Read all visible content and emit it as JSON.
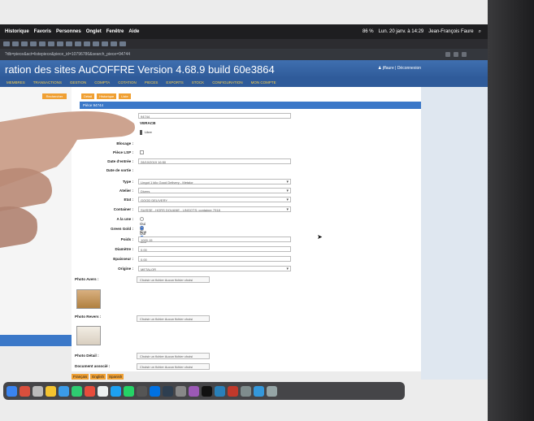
{
  "menubar": {
    "items": [
      "Historique",
      "Favoris",
      "Personnes",
      "Onglet",
      "Fenêtre",
      "Aide"
    ],
    "battery": "86 %",
    "datetime": "Lun. 20 janv. à 14:29",
    "user": "Jean-François Faure"
  },
  "address_bar": {
    "url": "?db=piece&act=listepiece&piece_id=10796786&search_piece=94744"
  },
  "header": {
    "title": "ration des sites AuCOFFRE  Version 4.68.9 build 60e3864",
    "user": "jffaure",
    "logout": "Déconnexion"
  },
  "nav": {
    "items": [
      "MEMBRES",
      "TRANSACTIONS",
      "GESTION",
      "COMPTA",
      "COTATION",
      "PIECES",
      "EXPORTS",
      "STOCK",
      "CONFIGURATION",
      "MON COMPTE"
    ]
  },
  "left_panel": {
    "button": "Rechercher"
  },
  "subtabs": [
    "Détail",
    "Historique",
    "Liste"
  ],
  "section_title": "Pièce 94744",
  "form": {
    "search_value": "94744",
    "code": "VERACB",
    "status": "Libre",
    "fields": [
      {
        "label": "Blocage :",
        "value": ""
      },
      {
        "label": "Pièce LSP :",
        "value": ""
      },
      {
        "label": "Date d'entrée :",
        "value": "28/10/2019 16:50"
      },
      {
        "label": "Date de sortie :",
        "value": ""
      },
      {
        "label": "Type :",
        "value": "Lingot 1 kilo Good Delivery - Metalor"
      },
      {
        "label": "Atelier :",
        "value": "Divers"
      },
      {
        "label": "Etat :",
        "value": "GOOD DELIVERY"
      },
      {
        "label": "Container :",
        "value": "SUISSE - HORS DOUANE - LINGOTS: container 7918"
      },
      {
        "label": "A la une :",
        "value": ""
      },
      {
        "label": "Green Gold :",
        "value": ""
      },
      {
        "label": "Poids :",
        "value": "1000.15"
      },
      {
        "label": "Diamètre :",
        "value": "0.00"
      },
      {
        "label": "Epaisseur :",
        "value": "0.00"
      },
      {
        "label": "Origine :",
        "value": "METALOR"
      }
    ],
    "radio_yes": "Oui",
    "radio_no": "Non",
    "file_fields": [
      {
        "label": "Photo Avers :"
      },
      {
        "label": "Photo Revers :"
      },
      {
        "label": "Photo Détail :"
      },
      {
        "label": "Document associé :"
      }
    ],
    "file_button": "Choisir un fichier",
    "file_none": "Aucun fichier choisi"
  },
  "languages": [
    "Français",
    "English",
    "Spanish"
  ]
}
